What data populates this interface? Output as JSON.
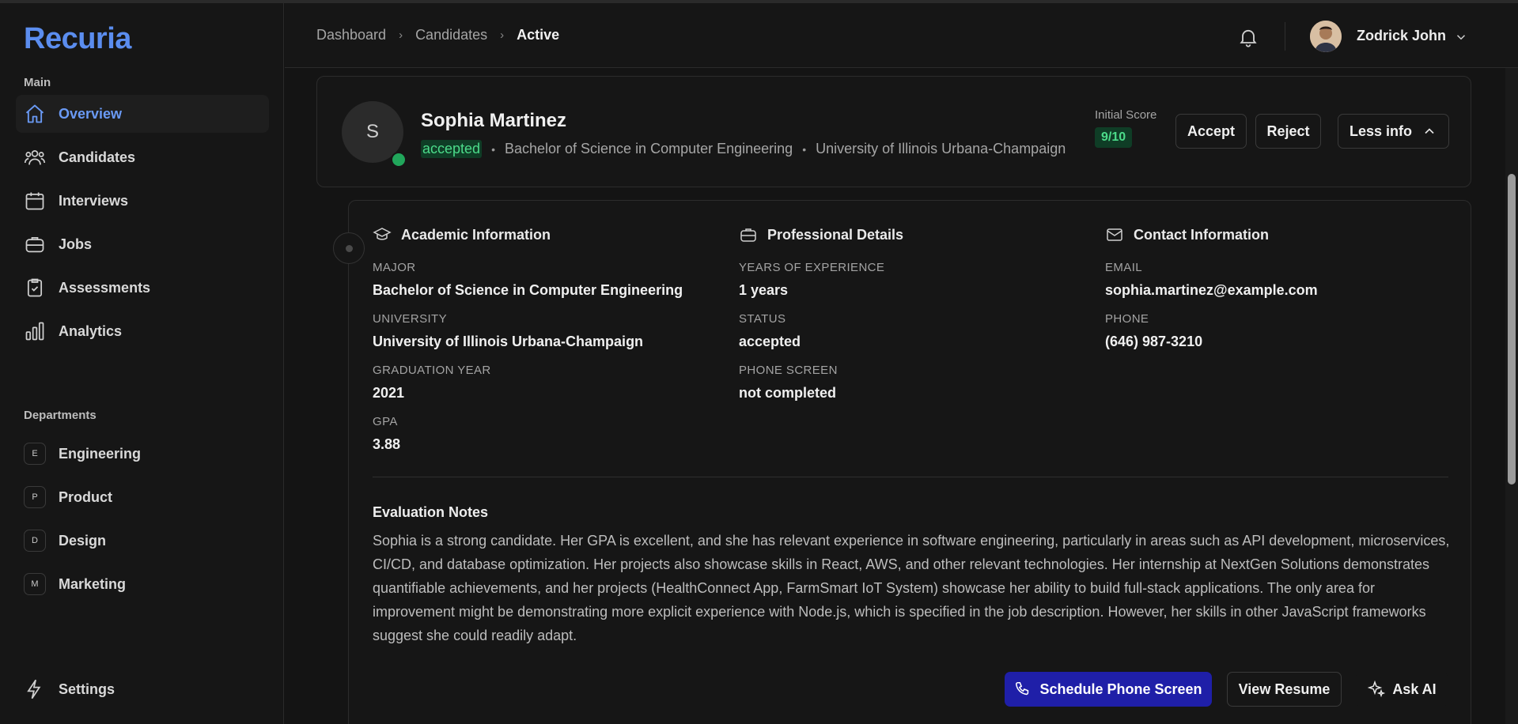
{
  "app": {
    "name": "Recuria"
  },
  "sidebar": {
    "main_label": "Main",
    "nav": [
      {
        "label": "Overview",
        "icon": "home-icon",
        "active": true
      },
      {
        "label": "Candidates",
        "icon": "users-icon"
      },
      {
        "label": "Interviews",
        "icon": "calendar-icon"
      },
      {
        "label": "Jobs",
        "icon": "briefcase-icon"
      },
      {
        "label": "Assessments",
        "icon": "clipboard-check-icon"
      },
      {
        "label": "Analytics",
        "icon": "bar-chart-icon"
      }
    ],
    "departments_label": "Departments",
    "departments": [
      {
        "badge": "E",
        "label": "Engineering"
      },
      {
        "badge": "P",
        "label": "Product"
      },
      {
        "badge": "D",
        "label": "Design"
      },
      {
        "badge": "M",
        "label": "Marketing"
      }
    ],
    "settings_label": "Settings"
  },
  "header": {
    "breadcrumb": [
      "Dashboard",
      "Candidates",
      "Active"
    ],
    "user_name": "Zodrick John"
  },
  "candidate": {
    "initial": "S",
    "name": "Sophia Martinez",
    "status": "accepted",
    "degree": "Bachelor of Science in Computer Engineering",
    "university": "University of Illinois Urbana-Champaign",
    "score_label": "Initial Score",
    "score": "9/10",
    "accept_label": "Accept",
    "reject_label": "Reject",
    "less_info_label": "Less info"
  },
  "details": {
    "academic": {
      "title": "Academic Information",
      "major_label": "MAJOR",
      "major": "Bachelor of Science in Computer Engineering",
      "university_label": "UNIVERSITY",
      "university": "University of Illinois Urbana-Champaign",
      "grad_year_label": "GRADUATION YEAR",
      "grad_year": "2021",
      "gpa_label": "GPA",
      "gpa": "3.88"
    },
    "professional": {
      "title": "Professional Details",
      "experience_label": "YEARS OF EXPERIENCE",
      "experience": "1 years",
      "status_label": "STATUS",
      "status": "accepted",
      "phone_screen_label": "PHONE SCREEN",
      "phone_screen": "not completed"
    },
    "contact": {
      "title": "Contact Information",
      "email_label": "EMAIL",
      "email": "sophia.martinez@example.com",
      "phone_label": "PHONE",
      "phone": "(646) 987-3210"
    },
    "notes_title": "Evaluation Notes",
    "notes": "Sophia is a strong candidate. Her GPA is excellent, and she has relevant experience in software engineering, particularly in areas such as API development, microservices, CI/CD, and database optimization. Her projects also showcase skills in React, AWS, and other relevant technologies. Her internship at NextGen Solutions demonstrates quantifiable achievements, and her projects (HealthConnect App, FarmSmart IoT System) showcase her ability to build full-stack applications. The only area for improvement might be demonstrating more explicit experience with Node.js, which is specified in the job description. However, her skills in other JavaScript frameworks suggest she could readily adapt."
  },
  "actions": {
    "schedule_label": "Schedule Phone Screen",
    "resume_label": "View Resume",
    "ask_ai_label": "Ask AI"
  },
  "colors": {
    "accent": "#5b8def",
    "primary_button": "#1f1fa8",
    "success": "#4cdb8a",
    "online": "#21a65b"
  }
}
